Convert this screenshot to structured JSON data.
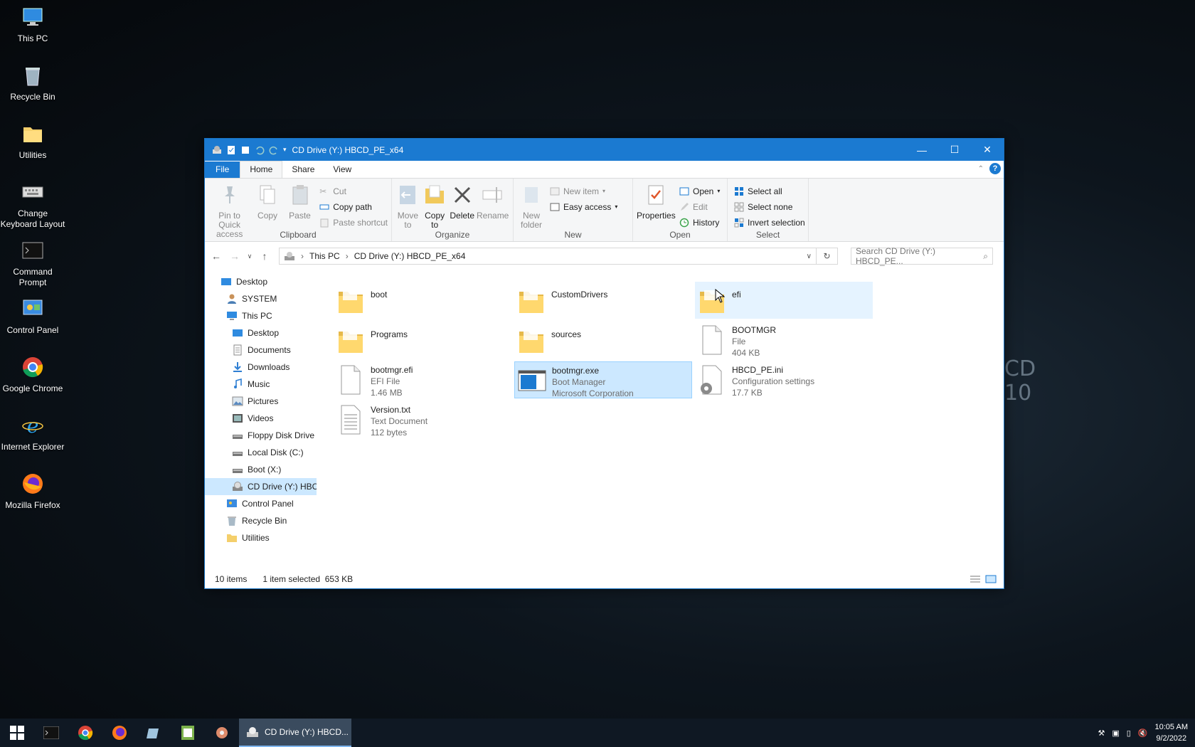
{
  "desktop": {
    "icons": [
      {
        "label": "This PC",
        "icon": "this-pc-icon"
      },
      {
        "label": "Recycle Bin",
        "icon": "recycle-bin-icon"
      },
      {
        "label": "Utilities",
        "icon": "folder-icon"
      },
      {
        "label": "Change Keyboard Layout",
        "icon": "keyboard-icon"
      },
      {
        "label": "Command Prompt",
        "icon": "command-prompt-icon"
      },
      {
        "label": "Control Panel",
        "icon": "control-panel-icon"
      },
      {
        "label": "Google Chrome",
        "icon": "chrome-icon"
      },
      {
        "label": "Internet Explorer",
        "icon": "internet-explorer-icon"
      },
      {
        "label": "Mozilla Firefox",
        "icon": "firefox-icon"
      }
    ],
    "wallpaper_text": [
      "CD",
      "10"
    ]
  },
  "window": {
    "title": "CD Drive (Y:) HBCD_PE_x64",
    "tabs": {
      "file": "File",
      "home": "Home",
      "share": "Share",
      "view": "View"
    },
    "ribbon": {
      "clipboard": {
        "label": "Clipboard",
        "pin": "Pin to Quick access",
        "copy": "Copy",
        "paste": "Paste",
        "cut": "Cut",
        "copy_path": "Copy path",
        "paste_shortcut": "Paste shortcut"
      },
      "organize": {
        "label": "Organize",
        "move_to": "Move to",
        "copy_to": "Copy to",
        "delete": "Delete",
        "rename": "Rename"
      },
      "new": {
        "label": "New",
        "new_folder": "New folder",
        "new_item": "New item",
        "easy_access": "Easy access"
      },
      "open": {
        "label": "Open",
        "properties": "Properties",
        "open": "Open",
        "edit": "Edit",
        "history": "History"
      },
      "select": {
        "label": "Select",
        "select_all": "Select all",
        "select_none": "Select none",
        "invert": "Invert selection"
      }
    },
    "address": {
      "crumbs": [
        "This PC",
        "CD Drive (Y:) HBCD_PE_x64"
      ],
      "search_placeholder": "Search CD Drive (Y:) HBCD_PE..."
    },
    "nav": [
      {
        "label": "Desktop",
        "icon": "desktop-icon",
        "indent": 0
      },
      {
        "label": "SYSTEM",
        "icon": "user-icon",
        "indent": 1
      },
      {
        "label": "This PC",
        "icon": "this-pc-icon",
        "indent": 1
      },
      {
        "label": "Desktop",
        "icon": "desktop-icon",
        "indent": 2
      },
      {
        "label": "Documents",
        "icon": "documents-icon",
        "indent": 2
      },
      {
        "label": "Downloads",
        "icon": "downloads-icon",
        "indent": 2
      },
      {
        "label": "Music",
        "icon": "music-icon",
        "indent": 2
      },
      {
        "label": "Pictures",
        "icon": "pictures-icon",
        "indent": 2
      },
      {
        "label": "Videos",
        "icon": "videos-icon",
        "indent": 2
      },
      {
        "label": "Floppy Disk Drive",
        "icon": "drive-icon",
        "indent": 2
      },
      {
        "label": "Local Disk (C:)",
        "icon": "drive-icon",
        "indent": 2
      },
      {
        "label": "Boot (X:)",
        "icon": "drive-icon",
        "indent": 2
      },
      {
        "label": "CD Drive (Y:) HBC",
        "icon": "cd-drive-icon",
        "indent": 2,
        "selected": true
      },
      {
        "label": "Control Panel",
        "icon": "control-panel-icon",
        "indent": 1
      },
      {
        "label": "Recycle Bin",
        "icon": "recycle-bin-icon",
        "indent": 1
      },
      {
        "label": "Utilities",
        "icon": "folder-icon",
        "indent": 1
      }
    ],
    "files": [
      {
        "name": "boot",
        "type": "",
        "detail": "",
        "kind": "folder"
      },
      {
        "name": "CustomDrivers",
        "type": "",
        "detail": "",
        "kind": "folder"
      },
      {
        "name": "efi",
        "type": "",
        "detail": "",
        "kind": "folder",
        "hover": true
      },
      {
        "name": "Programs",
        "type": "",
        "detail": "",
        "kind": "folder"
      },
      {
        "name": "sources",
        "type": "",
        "detail": "",
        "kind": "folder"
      },
      {
        "name": "BOOTMGR",
        "type": "File",
        "detail": "404 KB",
        "kind": "file"
      },
      {
        "name": "bootmgr.efi",
        "type": "EFI File",
        "detail": "1.46 MB",
        "kind": "file"
      },
      {
        "name": "bootmgr.exe",
        "type": "Boot Manager",
        "detail": "Microsoft Corporation",
        "kind": "exe",
        "selected": true
      },
      {
        "name": "HBCD_PE.ini",
        "type": "Configuration settings",
        "detail": "17.7 KB",
        "kind": "ini"
      },
      {
        "name": "Version.txt",
        "type": "Text Document",
        "detail": "112 bytes",
        "kind": "txt"
      }
    ],
    "status": {
      "count": "10 items",
      "selected": "1 item selected  653 KB"
    }
  },
  "taskbar": {
    "active_app": "CD Drive (Y:) HBCD...",
    "time": "10:05 AM",
    "date": "9/2/2022"
  },
  "colors": {
    "accent": "#1b7ad1",
    "selection": "#cce8ff",
    "taskbar": "#0f1823"
  }
}
